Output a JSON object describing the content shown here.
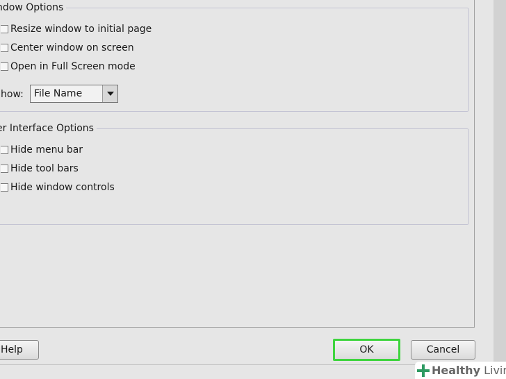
{
  "window_options": {
    "title": "ndow Options",
    "options": [
      {
        "label": "Resize window to initial page",
        "checked": false
      },
      {
        "label": "Center window on screen",
        "checked": false
      },
      {
        "label": "Open in Full Screen mode",
        "checked": false
      }
    ],
    "show_label": "how:",
    "show_select": {
      "value": "File Name"
    }
  },
  "ui_options": {
    "title": "er Interface Options",
    "options": [
      {
        "label": "Hide menu bar",
        "checked": false
      },
      {
        "label": "Hide tool bars",
        "checked": false
      },
      {
        "label": "Hide window controls",
        "checked": false
      }
    ]
  },
  "buttons": {
    "help": "Help",
    "ok": "OK",
    "cancel": "Cancel"
  },
  "watermark": {
    "brand_bold": "Healthy",
    "brand_light": " Living",
    "logo_icon": "cross-icon",
    "logo_color": "#2e9a62"
  },
  "colors": {
    "ok_highlight": "#3ed43e"
  }
}
